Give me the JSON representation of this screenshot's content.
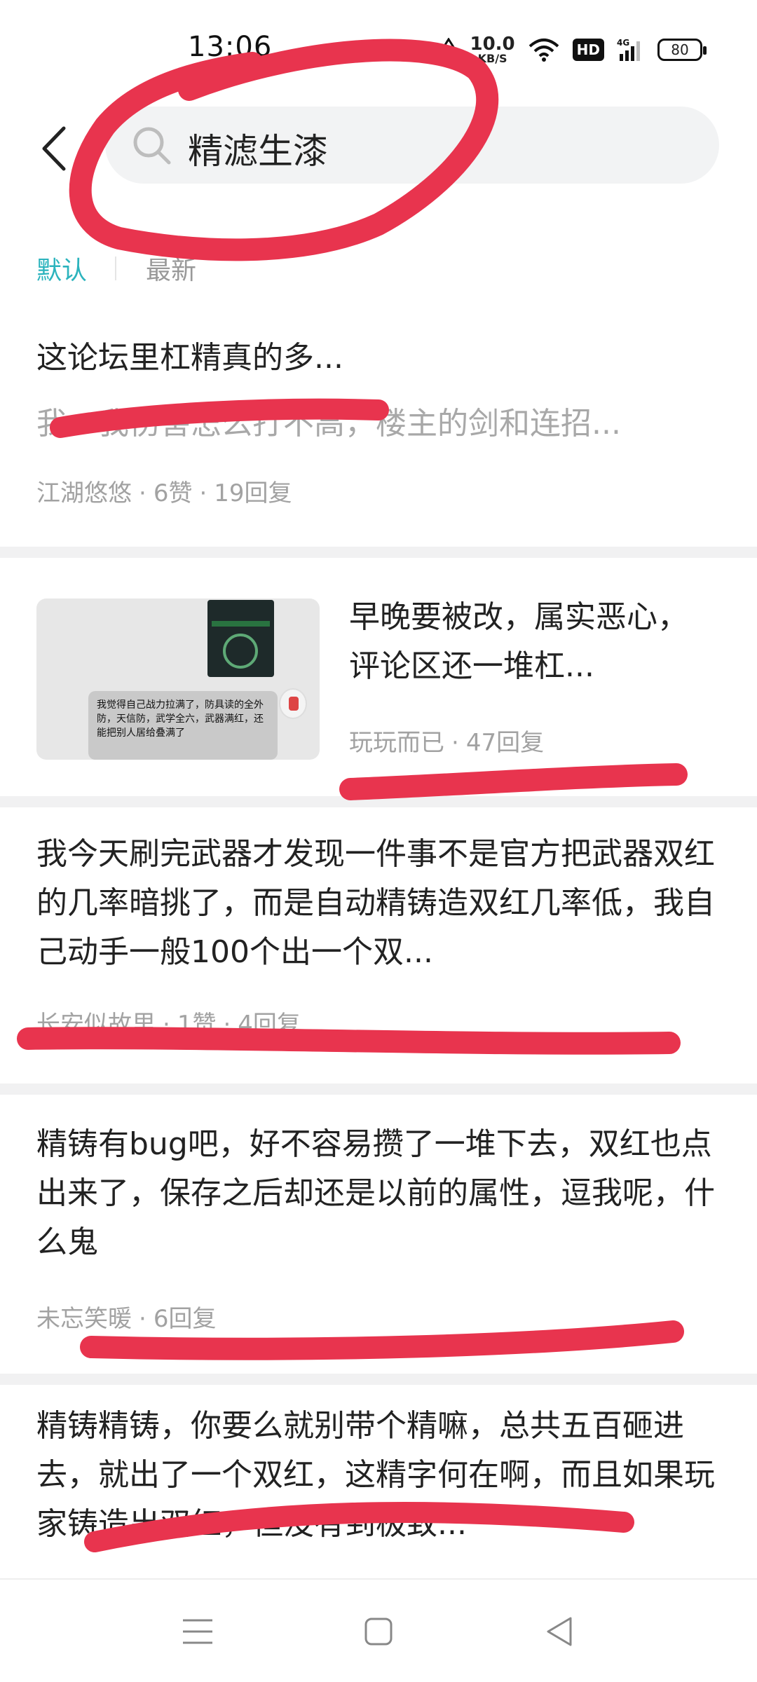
{
  "status_bar": {
    "time": "13:06",
    "net_speed_value": "10.0",
    "net_speed_unit": "KB/S",
    "hd_label": "HD",
    "network_label": "4G",
    "battery_level": "80"
  },
  "search": {
    "query": "精滤生漆"
  },
  "sort_tabs": [
    {
      "label": "默认",
      "active": true
    },
    {
      "label": "最新",
      "active": false
    }
  ],
  "posts": [
    {
      "title": "这论坛里杠精真的多...",
      "excerpt": "我一我伤害怎么打不高，楼主的剑和连招...",
      "author": "江湖悠悠",
      "likes": "6赞",
      "replies": "19回复"
    },
    {
      "title": "早晚要被改，属实恶心，评论区还一堆杠...",
      "author": "玩玩而已",
      "replies": "47回复",
      "thumbnail_text": "我觉得自己战力拉满了，防具读的全外防，天信防，武学全六，武器满红，还能把别人居给叠满了"
    },
    {
      "title": "我今天刷完武器才发现一件事不是官方把武器双红的几率暗挑了，而是自动精铸造双红几率低，我自己动手一般100个出一个双...",
      "author": "长安似故里",
      "likes": "1赞",
      "replies": "4回复"
    },
    {
      "title": "精铸有bug吧，好不容易攒了一堆下去，双红也点出来了，保存之后却还是以前的属性，逗我呢，什么鬼",
      "author": "未忘笑暖",
      "replies": "6回复"
    },
    {
      "title": "精铸精铸，你要么就别带个精嘛，总共五百砸进去，就出了一个双红，这精字何在啊，而且如果玩家铸造出双红，但没有到极致..."
    }
  ],
  "nav_bar": {
    "buttons": [
      "menu-icon",
      "home-icon",
      "back-triangle-icon"
    ]
  },
  "colors": {
    "accent": "#2bb3bd",
    "marker": "#e8344e",
    "separator": "#f1f1f2"
  }
}
